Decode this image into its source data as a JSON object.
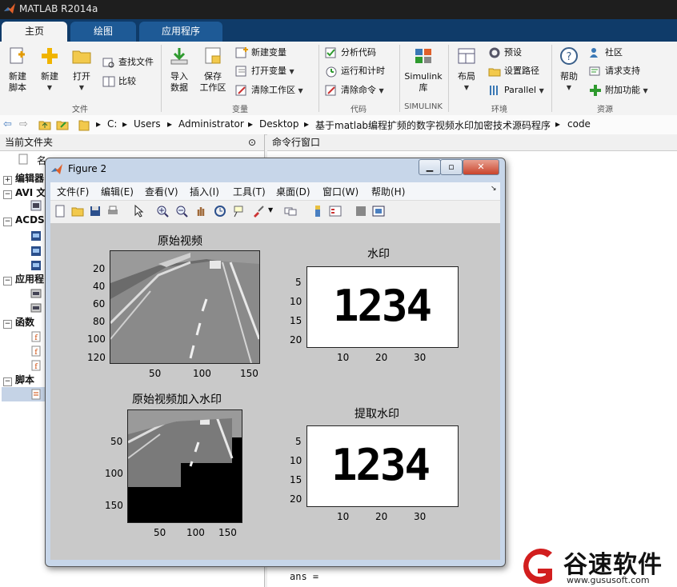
{
  "app": {
    "title": "MATLAB R2014a"
  },
  "ribbon_tabs": [
    {
      "label": "主页",
      "active": true
    },
    {
      "label": "绘图",
      "active": false
    },
    {
      "label": "应用程序",
      "active": false
    }
  ],
  "ribbon": {
    "file": {
      "new_script": "新建\n脚本",
      "new": "新建",
      "open": "打开",
      "find_files": "查找文件",
      "compare": "比较",
      "group": "文件"
    },
    "variable": {
      "import": "导入\n数据",
      "save_ws": "保存\n工作区",
      "new_var": "新建变量",
      "open_var": "打开变量",
      "clear_ws": "清除工作区",
      "group": "变量"
    },
    "code": {
      "analyze": "分析代码",
      "run_time": "运行和计时",
      "clear_cmd": "清除命令",
      "group": "代码"
    },
    "simulink": {
      "label": "Simulink\n库",
      "group": "SIMULINK"
    },
    "env": {
      "layout": "布局",
      "prefs": "预设",
      "set_path": "设置路径",
      "parallel": "Parallel",
      "group": "环境"
    },
    "resources": {
      "help": "帮助",
      "community": "社区",
      "request_support": "请求支持",
      "addons": "附加功能",
      "group": "资源"
    }
  },
  "address": {
    "crumbs": [
      "C:",
      "Users",
      "Administrator",
      "Desktop",
      "基于matlab编程扩频的数字视频水印加密技术源码程序",
      "code"
    ]
  },
  "current_folder": {
    "title": "当前文件夹",
    "col_name": "名",
    "groups": [
      {
        "label": "编辑器"
      },
      {
        "label": "AVI 文"
      },
      {
        "label": "ACDS"
      },
      {
        "label": "应用程"
      },
      {
        "label": "函数"
      },
      {
        "label": "脚本"
      }
    ]
  },
  "command_window": {
    "title": "命令行窗口",
    "prompt_line": "ans ="
  },
  "figure": {
    "title": "Figure 2",
    "menu": [
      "文件(F)",
      "编辑(E)",
      "查看(V)",
      "插入(I)",
      "工具(T)",
      "桌面(D)",
      "窗口(W)",
      "帮助(H)"
    ],
    "toolbar_icons": [
      "new-figure-icon",
      "open-icon",
      "save-icon",
      "print-icon",
      "pointer-icon",
      "zoom-in-icon",
      "zoom-out-icon",
      "pan-icon",
      "rotate-icon",
      "data-cursor-icon",
      "brush-icon",
      "link-icon",
      "colorbar-icon",
      "legend-icon",
      "hide-plot-tools-icon",
      "show-plot-tools-icon"
    ],
    "subplots": {
      "original": {
        "title": "原始视频",
        "yticks": [
          "20",
          "40",
          "60",
          "80",
          "100",
          "120"
        ],
        "xticks": [
          "50",
          "100",
          "150"
        ]
      },
      "watermark": {
        "title": "水印",
        "yticks": [
          "5",
          "10",
          "15",
          "20"
        ],
        "xticks": [
          "10",
          "20",
          "30"
        ],
        "text": "1234"
      },
      "watermarked": {
        "title": "原始视频加入水印",
        "yticks": [
          "50",
          "100",
          "150"
        ],
        "xticks": [
          "50",
          "100",
          "150"
        ]
      },
      "extracted": {
        "title": "提取水印",
        "yticks": [
          "5",
          "10",
          "15",
          "20"
        ],
        "xticks": [
          "10",
          "20",
          "30"
        ],
        "text": "1234"
      }
    }
  },
  "watermark_brand": {
    "name": "谷速软件",
    "url": "www.gususoft.com"
  },
  "colors": {
    "tab_bar": "#0f3b69",
    "figure_bg": "#c9c9c9",
    "brand": "#d21e1e"
  }
}
